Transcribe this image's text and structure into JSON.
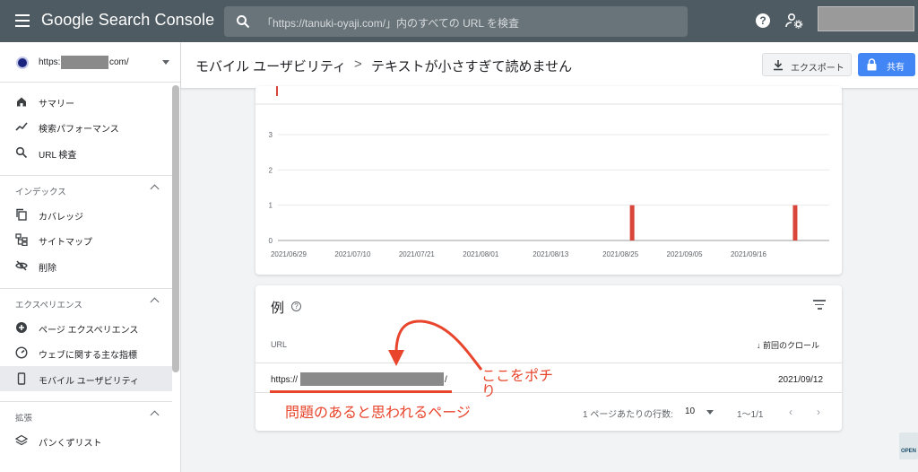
{
  "topbar": {
    "app_title": "Google Search Console",
    "search_placeholder": "「https://tanuki-oyaji.com/」内のすべての URL を検査",
    "help_icon": "help-icon",
    "settings_icon": "user-gear-icon"
  },
  "sidebar": {
    "property_prefix": "https:",
    "property_suffix": "com/",
    "items_top": [
      {
        "label": "サマリー",
        "icon": "home-icon"
      },
      {
        "label": "検索パフォーマンス",
        "icon": "trending-icon"
      },
      {
        "label": "URL 検査",
        "icon": "search-icon"
      }
    ],
    "section_index": "インデックス",
    "items_index": [
      {
        "label": "カバレッジ",
        "icon": "copy-icon"
      },
      {
        "label": "サイトマップ",
        "icon": "sitemap-icon"
      },
      {
        "label": "削除",
        "icon": "eye-off-icon"
      }
    ],
    "section_experience": "エクスペリエンス",
    "items_experience": [
      {
        "label": "ページ エクスペリエンス",
        "icon": "add-circle-icon"
      },
      {
        "label": "ウェブに関する主な指標",
        "icon": "speed-icon"
      },
      {
        "label": "モバイル ユーザビリティ",
        "icon": "phone-icon"
      }
    ],
    "section_extension": "拡張",
    "items_extension": [
      {
        "label": "パンくずリスト",
        "icon": "layers-icon"
      }
    ]
  },
  "header": {
    "crumb_parent": "モバイル ユーザビリティ",
    "crumb_separator": ">",
    "crumb_current": "テキストが小さすぎて読めません",
    "export_label": "エクスポート",
    "share_label": "共有"
  },
  "chart_data": {
    "type": "bar",
    "x_tick_labels": [
      "2021/06/29",
      "2021/07/10",
      "2021/07/21",
      "2021/08/01",
      "2021/08/13",
      "2021/08/25",
      "2021/09/05",
      "2021/09/16"
    ],
    "y_ticks": [
      0,
      1,
      2,
      3
    ],
    "ylim": [
      0,
      3
    ],
    "series": [
      {
        "values": [
          {
            "x": "2021/08/27",
            "y": 1
          },
          {
            "x": "2021/09/24",
            "y": 1
          }
        ]
      }
    ],
    "bar_color": "#d9453b"
  },
  "examples": {
    "title": "例",
    "col_url": "URL",
    "col_crawl": "前回のクロール",
    "rows": [
      {
        "url_prefix": "https://",
        "url_suffix": "/",
        "date": "2021/09/12"
      }
    ],
    "rows_per_page_label": "1 ページあたりの行数:",
    "rows_per_page": "10",
    "range": "1〜1/1"
  },
  "annotations": {
    "click_here": "ここをポチり",
    "problem_page": "問題のあると思われるページ",
    "color": "#e8452c"
  }
}
